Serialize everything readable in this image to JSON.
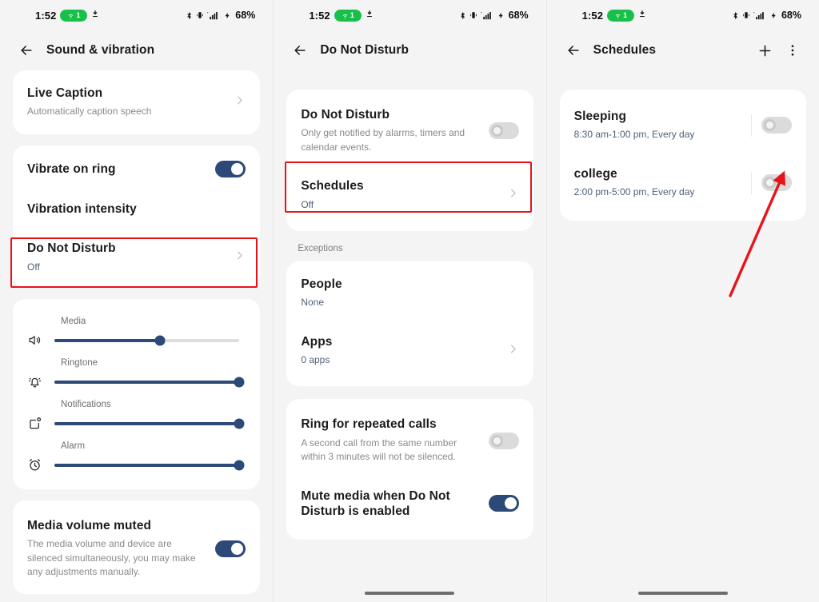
{
  "statusbar": {
    "time": "1:52",
    "pill_count": "1",
    "battery": "68%",
    "icons": [
      "wifi-hotspot-icon",
      "download-icon",
      "bluetooth-icon",
      "vibrate-icon",
      "signal-bars-icon",
      "charging-bolt-icon"
    ]
  },
  "panel1": {
    "title": "Sound & vibration",
    "live_caption": {
      "title": "Live Caption",
      "subtitle": "Automatically caption speech"
    },
    "vibrate_on_ring": {
      "title": "Vibrate on ring",
      "state": "on"
    },
    "vibration_intensity": {
      "title": "Vibration intensity"
    },
    "do_not_disturb": {
      "title": "Do Not Disturb",
      "subtitle": "Off",
      "highlighted": true
    },
    "sliders": [
      {
        "label": "Media",
        "icon": "speaker-icon",
        "value": 57
      },
      {
        "label": "Ringtone",
        "icon": "bell-icon",
        "value": 100
      },
      {
        "label": "Notifications",
        "icon": "notification-icon",
        "value": 100
      },
      {
        "label": "Alarm",
        "icon": "alarm-clock-icon",
        "value": 100
      }
    ],
    "media_volume_muted": {
      "title": "Media volume muted",
      "subtitle": "The media volume and device are silenced simultaneously, you may make any adjustments manually.",
      "state": "on"
    }
  },
  "panel2": {
    "title": "Do Not Disturb",
    "dnd": {
      "title": "Do Not Disturb",
      "subtitle": "Only get notified by alarms, timers and calendar events.",
      "state": "off"
    },
    "schedules": {
      "title": "Schedules",
      "subtitle": "Off",
      "highlighted": true
    },
    "exceptions_label": "Exceptions",
    "people": {
      "title": "People",
      "subtitle": "None"
    },
    "apps": {
      "title": "Apps",
      "subtitle": "0 apps"
    },
    "ring_repeated": {
      "title": "Ring for repeated calls",
      "subtitle": "A second call from the same number within 3 minutes will not be silenced.",
      "state": "off"
    },
    "mute_media": {
      "title": "Mute media when Do Not Disturb is enabled",
      "state": "on"
    }
  },
  "panel3": {
    "title": "Schedules",
    "add_label": "add-icon",
    "menu_label": "overflow-menu-icon",
    "items": [
      {
        "name": "Sleeping",
        "time": "8:30 am-1:00 pm, Every day",
        "state": "off"
      },
      {
        "name": "college",
        "time": "2:00 pm-5:00 pm, Every day",
        "state": "off"
      }
    ]
  },
  "annotation": {
    "color": "#e8131a"
  }
}
